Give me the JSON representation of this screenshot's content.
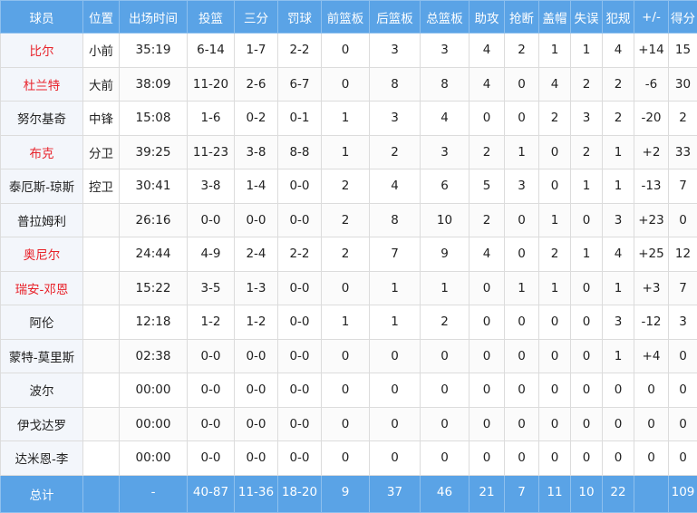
{
  "headers": [
    "球员",
    "位置",
    "出场时间",
    "投篮",
    "三分",
    "罚球",
    "前篮板",
    "后篮板",
    "总篮板",
    "助攻",
    "抢断",
    "盖帽",
    "失误",
    "犯规",
    "+/-",
    "得分"
  ],
  "rows": [
    {
      "name": "比尔",
      "highlight": true,
      "cells": [
        "小前",
        "35:19",
        "6-14",
        "1-7",
        "2-2",
        "0",
        "3",
        "3",
        "4",
        "2",
        "1",
        "1",
        "4",
        "+14",
        "15"
      ]
    },
    {
      "name": "杜兰特",
      "highlight": true,
      "cells": [
        "大前",
        "38:09",
        "11-20",
        "2-6",
        "6-7",
        "0",
        "8",
        "8",
        "4",
        "0",
        "4",
        "2",
        "2",
        "-6",
        "30"
      ]
    },
    {
      "name": "努尔基奇",
      "highlight": false,
      "cells": [
        "中锋",
        "15:08",
        "1-6",
        "0-2",
        "0-1",
        "1",
        "3",
        "4",
        "0",
        "0",
        "2",
        "3",
        "2",
        "-20",
        "2"
      ]
    },
    {
      "name": "布克",
      "highlight": true,
      "cells": [
        "分卫",
        "39:25",
        "11-23",
        "3-8",
        "8-8",
        "1",
        "2",
        "3",
        "2",
        "1",
        "0",
        "2",
        "1",
        "+2",
        "33"
      ]
    },
    {
      "name": "泰厄斯-琼斯",
      "highlight": false,
      "cells": [
        "控卫",
        "30:41",
        "3-8",
        "1-4",
        "0-0",
        "2",
        "4",
        "6",
        "5",
        "3",
        "0",
        "1",
        "1",
        "-13",
        "7"
      ]
    },
    {
      "name": "普拉姆利",
      "highlight": false,
      "cells": [
        "",
        "26:16",
        "0-0",
        "0-0",
        "0-0",
        "2",
        "8",
        "10",
        "2",
        "0",
        "1",
        "0",
        "3",
        "+23",
        "0"
      ]
    },
    {
      "name": "奥尼尔",
      "highlight": true,
      "cells": [
        "",
        "24:44",
        "4-9",
        "2-4",
        "2-2",
        "2",
        "7",
        "9",
        "4",
        "0",
        "2",
        "1",
        "4",
        "+25",
        "12"
      ]
    },
    {
      "name": "瑞安-邓恩",
      "highlight": true,
      "cells": [
        "",
        "15:22",
        "3-5",
        "1-3",
        "0-0",
        "0",
        "1",
        "1",
        "0",
        "1",
        "1",
        "0",
        "1",
        "+3",
        "7"
      ]
    },
    {
      "name": "阿伦",
      "highlight": false,
      "cells": [
        "",
        "12:18",
        "1-2",
        "1-2",
        "0-0",
        "1",
        "1",
        "2",
        "0",
        "0",
        "0",
        "0",
        "3",
        "-12",
        "3"
      ]
    },
    {
      "name": "蒙特-莫里斯",
      "highlight": false,
      "cells": [
        "",
        "02:38",
        "0-0",
        "0-0",
        "0-0",
        "0",
        "0",
        "0",
        "0",
        "0",
        "0",
        "0",
        "1",
        "+4",
        "0"
      ]
    },
    {
      "name": "波尔",
      "highlight": false,
      "cells": [
        "",
        "00:00",
        "0-0",
        "0-0",
        "0-0",
        "0",
        "0",
        "0",
        "0",
        "0",
        "0",
        "0",
        "0",
        "0",
        "0"
      ]
    },
    {
      "name": "伊戈达罗",
      "highlight": false,
      "cells": [
        "",
        "00:00",
        "0-0",
        "0-0",
        "0-0",
        "0",
        "0",
        "0",
        "0",
        "0",
        "0",
        "0",
        "0",
        "0",
        "0"
      ]
    },
    {
      "name": "达米恩-李",
      "highlight": false,
      "cells": [
        "",
        "00:00",
        "0-0",
        "0-0",
        "0-0",
        "0",
        "0",
        "0",
        "0",
        "0",
        "0",
        "0",
        "0",
        "0",
        "0"
      ]
    }
  ],
  "totals": [
    "总计",
    "",
    "-",
    "40-87",
    "11-36",
    "18-20",
    "9",
    "37",
    "46",
    "21",
    "7",
    "11",
    "10",
    "22",
    "",
    "109"
  ],
  "colors": {
    "header_bg": "#5aa3e6",
    "highlight_name": "#e8232b",
    "name_bg": "#f3f6fb"
  }
}
